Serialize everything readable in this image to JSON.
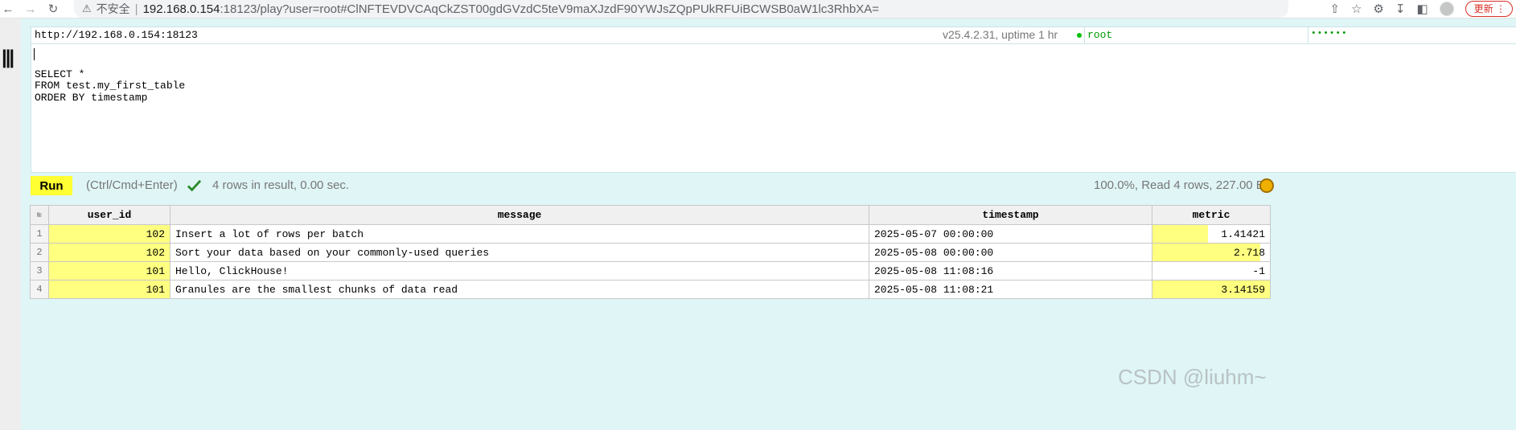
{
  "browser": {
    "insecure_label": "不安全",
    "url_host": "192.168.0.154",
    "url_rest": ":18123/play?user=root#ClNFTEVDVCAqCkZST00gdGVzdC5teV9maXJzdF90YWJsZQpPUkRFUiBCWSB0aW1lc3RhbXA=",
    "update_label": "更新"
  },
  "connection": {
    "server_url": "http://192.168.0.154:18123",
    "version_info": "v25.4.2.31, uptime 1 hr",
    "user": "root",
    "password_mask": "••••••"
  },
  "editor": {
    "query": "\nSELECT *\nFROM test.my_first_table\nORDER BY timestamp"
  },
  "controls": {
    "run_label": "Run",
    "shortcut_hint": "(Ctrl/Cmd+Enter)",
    "result_info": "4 rows in result, 0.00 sec.",
    "stats": "100.0%, Read 4 rows, 227.00 B"
  },
  "table": {
    "row_number_header": "№",
    "columns": [
      "user_id",
      "message",
      "timestamp",
      "metric"
    ],
    "rows": [
      {
        "num": "1",
        "user_id": "102",
        "message": "Insert a lot of rows per batch",
        "timestamp": "2025-05-07 00:00:00",
        "metric": "1.41421"
      },
      {
        "num": "2",
        "user_id": "102",
        "message": "Sort your data based on your commonly-used queries",
        "timestamp": "2025-05-08 00:00:00",
        "metric": "2.718"
      },
      {
        "num": "3",
        "user_id": "101",
        "message": "Hello, ClickHouse!",
        "timestamp": "2025-05-08 11:08:16",
        "metric": "-1"
      },
      {
        "num": "4",
        "user_id": "101",
        "message": "Granules are the smallest chunks of data read",
        "timestamp": "2025-05-08 11:08:21",
        "metric": "3.14159"
      }
    ],
    "user_id_bar_fraction": [
      1.0,
      1.0,
      1.0,
      1.0
    ],
    "metric_bar_fraction": [
      0.47,
      0.92,
      0.0,
      1.0
    ]
  },
  "watermark": "CSDN @liuhm~",
  "colors": {
    "app_background": "#dff5f6",
    "run_button": "#ffff33",
    "cell_bar": "#ffff80",
    "user_text": "#009900"
  },
  "icons": [
    "back-arrow-icon",
    "forward-arrow-icon",
    "reload-icon",
    "warning-icon",
    "share-icon",
    "star-icon",
    "extensions-icon",
    "download-icon",
    "sidebar-icon",
    "checkmark-icon",
    "theme-toggle-icon"
  ]
}
